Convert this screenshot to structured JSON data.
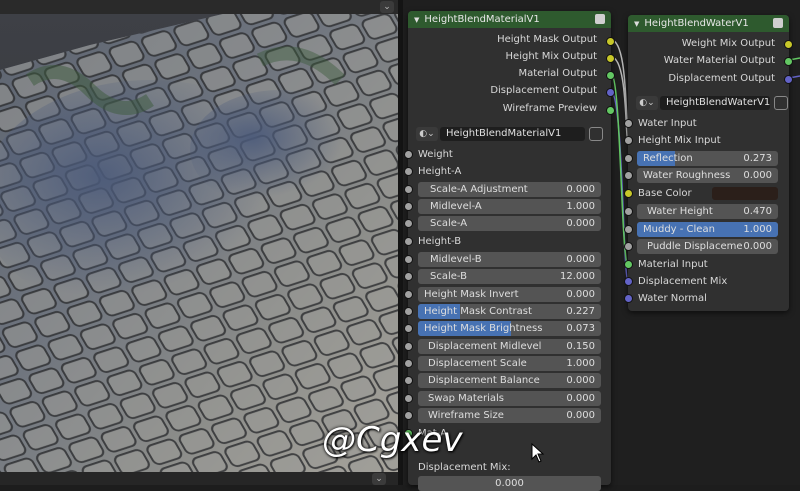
{
  "watermark": "@Cgxev",
  "material_node": {
    "title": "HeightBlendMaterialV1",
    "outputs": [
      "Height Mask Output",
      "Height Mix Output",
      "Material Output",
      "Displacement Output",
      "Wireframe Preview"
    ],
    "group_name": "HeightBlendMaterialV1",
    "rows": [
      {
        "type": "socket",
        "label": "Weight"
      },
      {
        "type": "socket",
        "label": "Height-A"
      },
      {
        "type": "field",
        "label": "Scale-A Adjustment",
        "value": "0.000"
      },
      {
        "type": "field",
        "label": "Midlevel-A",
        "value": "1.000"
      },
      {
        "type": "field",
        "label": "Scale-A",
        "value": "0.000"
      },
      {
        "type": "socket",
        "label": "Height-B"
      },
      {
        "type": "field",
        "label": "Midlevel-B",
        "value": "0.000"
      },
      {
        "type": "field",
        "label": "Scale-B",
        "value": "12.000"
      },
      {
        "type": "field",
        "label": "Height Mask Invert",
        "value": "0.000"
      },
      {
        "type": "field",
        "label": "Height Mask Contrast",
        "value": "0.227",
        "fill": 0.227
      },
      {
        "type": "field",
        "label": "Height Mask  Brightness",
        "value": "0.073",
        "fill": 0.51
      },
      {
        "type": "field",
        "label": "Displacement Midlevel",
        "value": "0.150"
      },
      {
        "type": "field",
        "label": "Displacement Scale",
        "value": "1.000"
      },
      {
        "type": "field",
        "label": "Displacement Balance",
        "value": "0.000"
      },
      {
        "type": "field",
        "label": "Swap Materials",
        "value": "0.000"
      },
      {
        "type": "field",
        "label": "Wireframe Size",
        "value": "0.000"
      },
      {
        "type": "socket",
        "label": "Mat-A"
      }
    ],
    "displacement_mix_label": "Displacement Mix:",
    "displacement_mix_value": "0.000"
  },
  "water_node": {
    "title": "HeightBlendWaterV1",
    "outputs": [
      "Weight Mix Output",
      "Water Material Output",
      "Displacement Output"
    ],
    "group_name": "HeightBlendWaterV1",
    "rows": [
      {
        "type": "socket",
        "label": "Water Input"
      },
      {
        "type": "socket",
        "label": "Height Mix Input"
      },
      {
        "type": "field",
        "label": "Reflection",
        "value": "0.273",
        "fill": 0.273
      },
      {
        "type": "field",
        "label": "Water Roughness",
        "value": "0.000"
      },
      {
        "type": "color",
        "label": "Base Color",
        "color": "#2b1f1a"
      },
      {
        "type": "field",
        "label": "Water Height",
        "value": "0.470"
      },
      {
        "type": "field",
        "label": "Muddy - Clean",
        "value": "1.000",
        "fill": 1.0
      },
      {
        "type": "field",
        "label": "Puddle Displaceme",
        "value": "0.000"
      },
      {
        "type": "socket",
        "label": "Material Input"
      },
      {
        "type": "socket",
        "label": "Displacement Mix"
      },
      {
        "type": "socket",
        "label": "Water Normal"
      }
    ]
  },
  "colors": {
    "node_header": "#2e5a2e",
    "field_fill": "#4772b3",
    "socket_yellow": "#c7c729",
    "socket_green": "#63c763",
    "socket_blue": "#6363c7",
    "socket_grey": "#a1a1a1"
  }
}
